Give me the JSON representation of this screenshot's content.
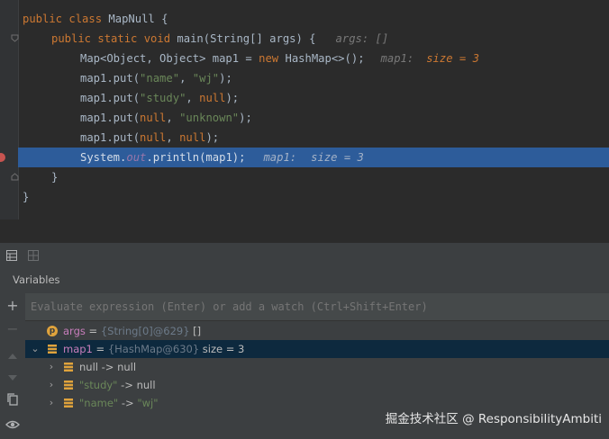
{
  "editor": {
    "lines": [
      {
        "p": [
          "public class",
          " MapNull {"
        ]
      },
      {
        "p": [
          "public static void",
          " main(String[] args) {",
          "args: []"
        ]
      },
      {
        "p": [
          "Map<Object, Object> map1 = ",
          "new",
          " HashMap<>();",
          "map1:",
          "size = 3"
        ]
      },
      {
        "p": [
          "map1.put(",
          "\"name\"",
          ", ",
          "\"wj\"",
          ");"
        ]
      },
      {
        "p": [
          "map1.put(",
          "\"study\"",
          ", ",
          "null",
          ");"
        ]
      },
      {
        "p": [
          "map1.put(",
          "null",
          ", ",
          "\"unknown\"",
          ");"
        ]
      },
      {
        "p": [
          "map1.put(",
          "null",
          ", ",
          "null",
          ");"
        ]
      },
      {
        "p": [
          "System.",
          "out",
          ".println(map1);",
          "map1:",
          "size = 3"
        ]
      },
      {
        "p": [
          "}"
        ]
      },
      {
        "p": [
          "}"
        ]
      }
    ]
  },
  "debugger": {
    "panel_title": "Variables",
    "eval_placeholder": "Evaluate expression (Enter) or add a watch (Ctrl+Shift+Enter)",
    "tree": [
      {
        "name": "args",
        "eq": " = ",
        "type": "{String[0]@629}",
        "value": " []",
        "badge": "p"
      },
      {
        "name": "map1",
        "eq": " = ",
        "type": "{HashMap@630}",
        "value": "  size = 3",
        "selected": true
      },
      {
        "key": "null",
        "arrow": " -> ",
        "val": "null"
      },
      {
        "key": "\"study\"",
        "arrow": " -> ",
        "val": "null"
      },
      {
        "key": "\"name\"",
        "arrow": " -> ",
        "val": "\"wj\""
      }
    ]
  },
  "watermark": "掘金技术社区 @ ResponsibilityAmbiti",
  "colors": {
    "keyword": "#cc7832",
    "string": "#6a8759",
    "field": "#9876aa",
    "selection": "#2d5c9a",
    "tree_selection": "#0d293e"
  }
}
